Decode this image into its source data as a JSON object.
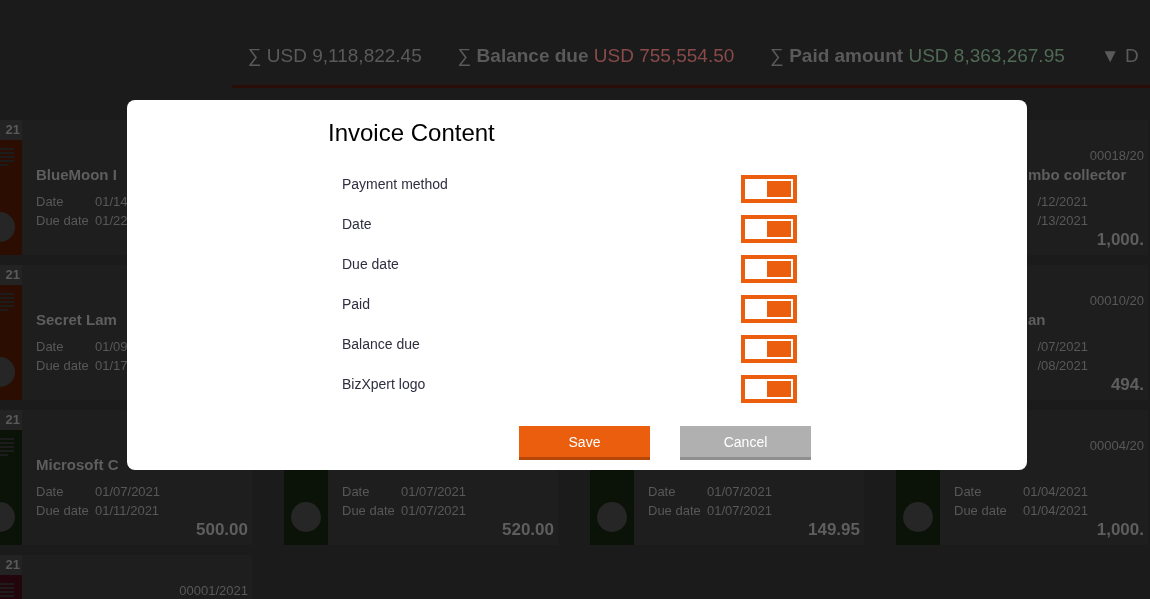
{
  "header": {
    "totals": [
      {
        "symbol": "∑",
        "amount": "USD 9,118,822.45",
        "color": "#5a5a5a"
      },
      {
        "symbol": "∑",
        "label": "Balance due",
        "amount": "USD 755,554.50",
        "color": "#8a4a4a"
      },
      {
        "symbol": "∑",
        "label": "Paid amount",
        "amount": "USD 8,363,267.95",
        "color": "#4f6a55"
      }
    ],
    "sort": {
      "arrow": "▼",
      "label": "D"
    }
  },
  "card_rows": [
    {
      "cards": [
        {
          "kind": "card",
          "color": "#2b0d02",
          "tab": "21",
          "title": "BlueMoon I",
          "date_label": "Date",
          "date": "01/14",
          "due_label": "Due date",
          "due_date": "01/22"
        },
        {
          "kind": "hidden"
        },
        {
          "kind": "hidden"
        },
        {
          "kind": "card",
          "number": "00018/20",
          "title": "mbo collector",
          "date": "/12/2021",
          "due_date": "/13/2021",
          "amount": "1,000."
        }
      ]
    },
    {
      "cards": [
        {
          "kind": "card",
          "color": "#2b0d02",
          "tab": "21",
          "title": "Secret Lam",
          "date_label": "Date",
          "date": "01/09",
          "due_label": "Due date",
          "due_date": "01/17"
        },
        {
          "kind": "hidden"
        },
        {
          "kind": "hidden"
        },
        {
          "kind": "card",
          "number": "00010/20",
          "title": "an",
          "date": "/07/2021",
          "due_date": "/08/2021",
          "amount": "494."
        }
      ]
    },
    {
      "cards": [
        {
          "kind": "card",
          "color": "#0b1207",
          "tab": "21",
          "title": "Microsoft C",
          "date_label": "Date",
          "date": "01/07/2021",
          "due_label": "Due date",
          "due_date": "01/11/2021",
          "amount": "500.00"
        },
        {
          "kind": "card",
          "color": "#0b1207",
          "date_label": "Date",
          "date": "01/07/2021",
          "due_label": "Due date",
          "due_date": "01/07/2021",
          "amount": "520.00"
        },
        {
          "kind": "card",
          "color": "#0b1207",
          "date_label": "Date",
          "date": "01/07/2021",
          "due_label": "Due date",
          "due_date": "01/07/2021",
          "amount": "149.95"
        },
        {
          "kind": "card",
          "color": "#0b1207",
          "number": "00004/20",
          "date_label": "Date",
          "date": "01/04/2021",
          "due_label": "Due date",
          "due_date": "01/04/2021",
          "amount": "1,000."
        }
      ]
    },
    {
      "cards": [
        {
          "kind": "card",
          "color": "#23060d",
          "tab": "21",
          "number": "00001/2021"
        }
      ]
    }
  ],
  "dialog": {
    "title": "Invoice Content",
    "options": [
      {
        "label": "Payment method",
        "on": true
      },
      {
        "label": "Date",
        "on": true
      },
      {
        "label": "Due date",
        "on": true
      },
      {
        "label": "Paid",
        "on": true
      },
      {
        "label": "Balance due",
        "on": true
      },
      {
        "label": "BizXpert logo",
        "on": true
      }
    ],
    "buttons": [
      {
        "label": "Save",
        "kind": "primary"
      },
      {
        "label": "Cancel",
        "kind": "secondary"
      }
    ]
  }
}
